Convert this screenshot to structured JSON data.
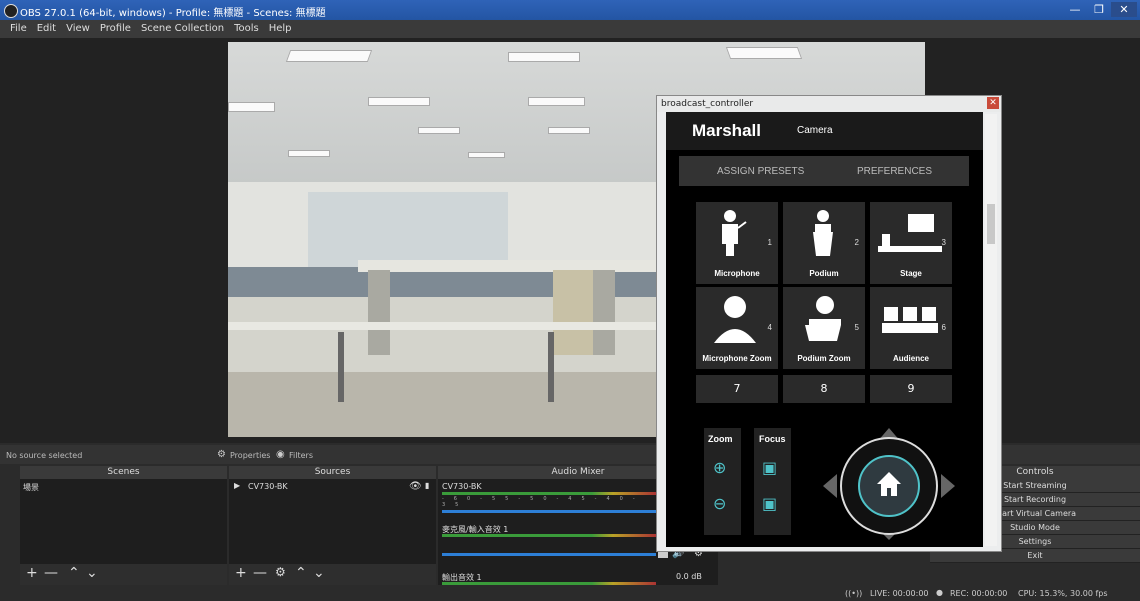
{
  "window": {
    "title": "OBS 27.0.1 (64-bit, windows) - Profile: 無標題 - Scenes: 無標題"
  },
  "menu": [
    "File",
    "Edit",
    "View",
    "Profile",
    "Scene Collection",
    "Tools",
    "Help"
  ],
  "propbar": {
    "no_source": "No source selected",
    "properties": "Properties",
    "filters": "Filters"
  },
  "scenes": {
    "header": "Scenes",
    "items": [
      "場景"
    ]
  },
  "sources": {
    "header": "Sources",
    "items": [
      "CV730-BK"
    ]
  },
  "mixer": {
    "header": "Audio Mixer",
    "channels": [
      {
        "name": "CV730-BK",
        "level": ""
      },
      {
        "name": "麥克風/輸入音效 1",
        "level": ""
      },
      {
        "name": "輸出音效 1",
        "level": "0.0 dB"
      }
    ],
    "ticks": [
      "-60",
      "-55",
      "-50",
      "-45",
      "-40",
      "-35",
      "-30",
      "-25",
      "-20",
      "-15"
    ]
  },
  "controls": {
    "header": "Controls",
    "buttons": [
      "Start Streaming",
      "Start Recording",
      "Start Virtual Camera",
      "Studio Mode",
      "Settings",
      "Exit"
    ]
  },
  "status": {
    "live": "LIVE: 00:00:00",
    "rec": "REC: 00:00:00",
    "cpu": "CPU: 15.3%, 30.00 fps"
  },
  "controller": {
    "window_title": "broadcast_controller",
    "brand": "Marshall",
    "subtitle": "Camera",
    "tabs": [
      "ASSIGN PRESETS",
      "PREFERENCES"
    ],
    "presets": [
      {
        "label": "Microphone",
        "num": "1"
      },
      {
        "label": "Podium",
        "num": "2"
      },
      {
        "label": "Stage",
        "num": "3"
      },
      {
        "label": "Microphone Zoom",
        "num": "4"
      },
      {
        "label": "Podium Zoom",
        "num": "5"
      },
      {
        "label": "Audience",
        "num": "6"
      }
    ],
    "numbered": [
      "7",
      "8",
      "9"
    ],
    "zoom_label": "Zoom",
    "focus_label": "Focus",
    "accent": "#4fc3c9"
  }
}
